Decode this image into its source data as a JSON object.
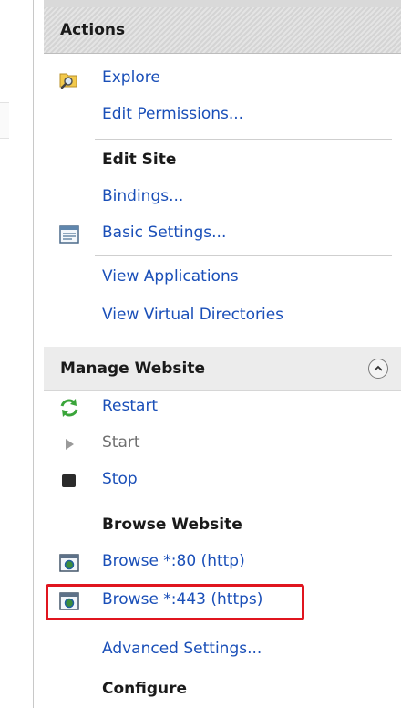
{
  "actions_header": "Actions",
  "explore": "Explore",
  "edit_permissions": "Edit Permissions...",
  "edit_site": {
    "heading": "Edit Site",
    "bindings": "Bindings...",
    "basic_settings": "Basic Settings...",
    "view_applications": "View Applications",
    "view_virtual_directories": "View Virtual Directories"
  },
  "manage_website": {
    "header": "Manage Website",
    "restart": "Restart",
    "start": "Start",
    "stop": "Stop",
    "browse_heading": "Browse Website",
    "browse_http": "Browse *:80 (http)",
    "browse_https": "Browse *:443 (https)",
    "advanced_settings": "Advanced Settings...",
    "configure_heading": "Configure"
  },
  "colors": {
    "link": "#1a4fb8",
    "highlight_border": "#e0151f",
    "disabled": "#6f6f6f"
  },
  "icons": {
    "explore": "folder-magnifier-icon",
    "basic_settings": "settings-list-icon",
    "collapse": "chevron-up-icon",
    "restart": "restart-arrows-icon",
    "start": "play-icon",
    "stop": "stop-icon",
    "browse": "browser-globe-icon"
  }
}
